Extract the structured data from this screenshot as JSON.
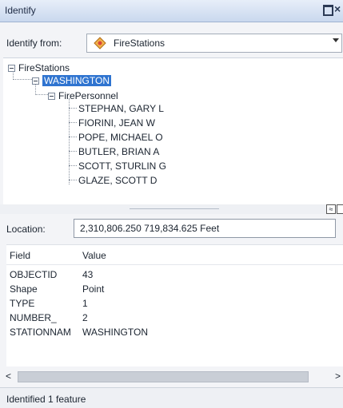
{
  "window": {
    "title": "Identify",
    "maximize_icon": "maximize-icon",
    "close_icon": "close-icon"
  },
  "identify_from": {
    "label": "Identify from:",
    "value": "FireStations",
    "icon": "layer-icon"
  },
  "tree": {
    "root": "FireStations",
    "feature": "WASHINGTON",
    "related": "FirePersonnel",
    "personnel": [
      "STEPHAN, GARY L",
      "FIORINI, JEAN W",
      "POPE, MICHAEL O",
      "BUTLER, BRIAN A",
      "SCOTT, STURLIN G",
      "GLAZE, SCOTT D"
    ]
  },
  "location": {
    "label": "Location:",
    "value": "2,310,806.250  719,834.625 Feet"
  },
  "attributes": {
    "columns": [
      "Field",
      "Value"
    ],
    "rows": [
      {
        "field": "OBJECTID",
        "value": "43"
      },
      {
        "field": "Shape",
        "value": "Point"
      },
      {
        "field": "TYPE",
        "value": "1"
      },
      {
        "field": "NUMBER_",
        "value": "2"
      },
      {
        "field": "STATIONNAM",
        "value": "WASHINGTON"
      }
    ]
  },
  "scrollbar": {
    "left_arrow": "<",
    "right_arrow": ">"
  },
  "status": {
    "text": "Identified 1 feature"
  },
  "colors": {
    "selection": "#2f74d0",
    "titlebar": "#c9d8ee"
  }
}
